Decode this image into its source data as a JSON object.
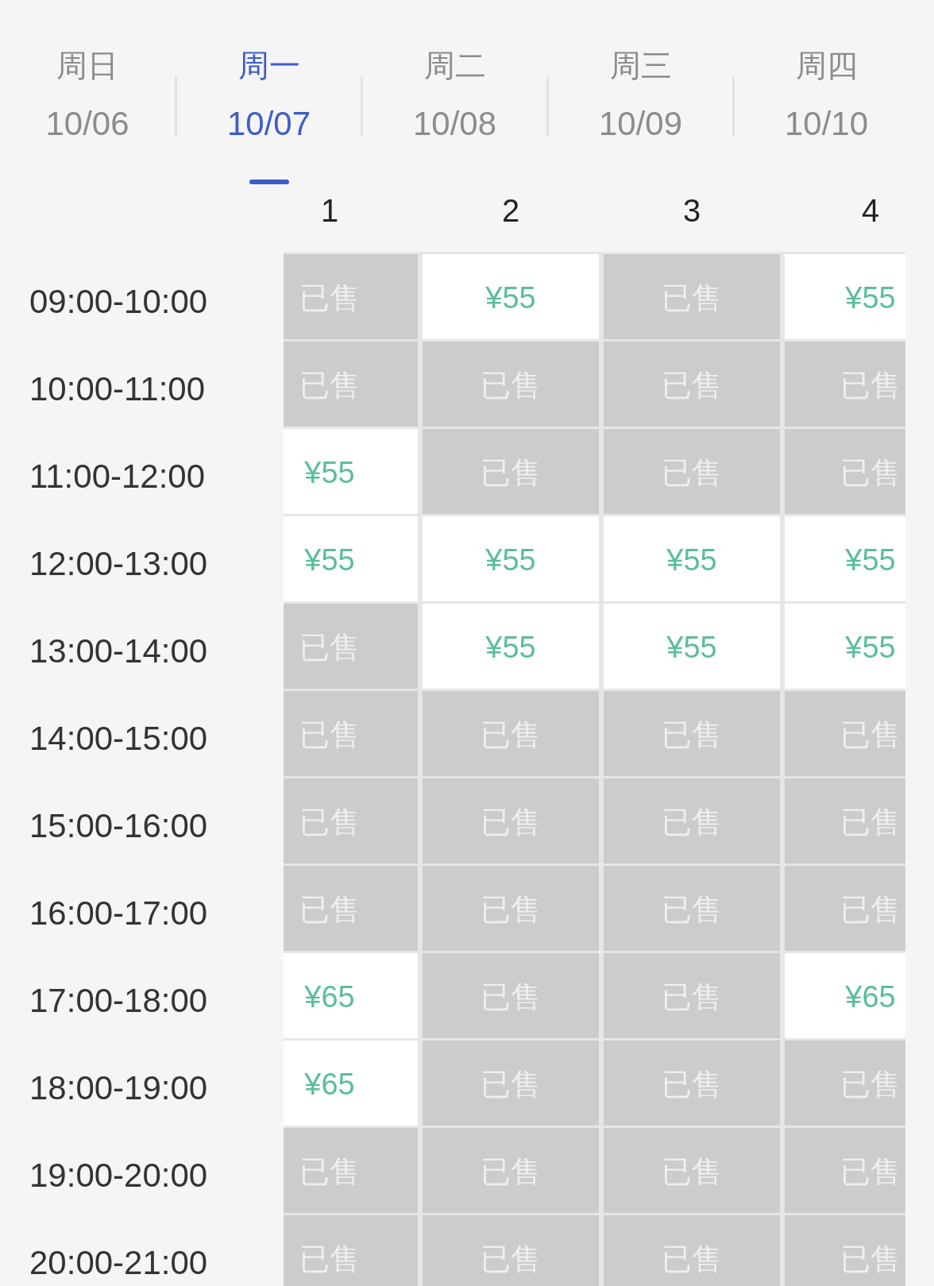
{
  "day_tabs": [
    {
      "weekday": "周日",
      "date": "10/06",
      "selected": false
    },
    {
      "weekday": "周一",
      "date": "10/07",
      "selected": true
    },
    {
      "weekday": "周二",
      "date": "10/08",
      "selected": false
    },
    {
      "weekday": "周三",
      "date": "10/09",
      "selected": false
    },
    {
      "weekday": "周四",
      "date": "10/10",
      "selected": false
    }
  ],
  "court_columns": [
    "1",
    "2",
    "3",
    "4"
  ],
  "time_slots": [
    {
      "time": "09:00-10:00",
      "cells": [
        {
          "kind": "sold",
          "text": "已售"
        },
        {
          "kind": "available",
          "text": "¥55"
        },
        {
          "kind": "sold",
          "text": "已售"
        },
        {
          "kind": "available",
          "text": "¥55"
        }
      ]
    },
    {
      "time": "10:00-11:00",
      "cells": [
        {
          "kind": "sold",
          "text": "已售"
        },
        {
          "kind": "sold",
          "text": "已售"
        },
        {
          "kind": "sold",
          "text": "已售"
        },
        {
          "kind": "sold",
          "text": "已售"
        }
      ]
    },
    {
      "time": "11:00-12:00",
      "cells": [
        {
          "kind": "available",
          "text": "¥55"
        },
        {
          "kind": "sold",
          "text": "已售"
        },
        {
          "kind": "sold",
          "text": "已售"
        },
        {
          "kind": "sold",
          "text": "已售"
        }
      ]
    },
    {
      "time": "12:00-13:00",
      "cells": [
        {
          "kind": "available",
          "text": "¥55"
        },
        {
          "kind": "available",
          "text": "¥55"
        },
        {
          "kind": "available",
          "text": "¥55"
        },
        {
          "kind": "available",
          "text": "¥55"
        }
      ]
    },
    {
      "time": "13:00-14:00",
      "cells": [
        {
          "kind": "sold",
          "text": "已售"
        },
        {
          "kind": "available",
          "text": "¥55"
        },
        {
          "kind": "available",
          "text": "¥55"
        },
        {
          "kind": "available",
          "text": "¥55"
        }
      ]
    },
    {
      "time": "14:00-15:00",
      "cells": [
        {
          "kind": "sold",
          "text": "已售"
        },
        {
          "kind": "sold",
          "text": "已售"
        },
        {
          "kind": "sold",
          "text": "已售"
        },
        {
          "kind": "sold",
          "text": "已售"
        }
      ]
    },
    {
      "time": "15:00-16:00",
      "cells": [
        {
          "kind": "sold",
          "text": "已售"
        },
        {
          "kind": "sold",
          "text": "已售"
        },
        {
          "kind": "sold",
          "text": "已售"
        },
        {
          "kind": "sold",
          "text": "已售"
        }
      ]
    },
    {
      "time": "16:00-17:00",
      "cells": [
        {
          "kind": "sold",
          "text": "已售"
        },
        {
          "kind": "sold",
          "text": "已售"
        },
        {
          "kind": "sold",
          "text": "已售"
        },
        {
          "kind": "sold",
          "text": "已售"
        }
      ]
    },
    {
      "time": "17:00-18:00",
      "cells": [
        {
          "kind": "available",
          "text": "¥65"
        },
        {
          "kind": "sold",
          "text": "已售"
        },
        {
          "kind": "sold",
          "text": "已售"
        },
        {
          "kind": "available",
          "text": "¥65"
        }
      ]
    },
    {
      "time": "18:00-19:00",
      "cells": [
        {
          "kind": "available",
          "text": "¥65"
        },
        {
          "kind": "sold",
          "text": "已售"
        },
        {
          "kind": "sold",
          "text": "已售"
        },
        {
          "kind": "sold",
          "text": "已售"
        }
      ]
    },
    {
      "time": "19:00-20:00",
      "cells": [
        {
          "kind": "sold",
          "text": "已售"
        },
        {
          "kind": "sold",
          "text": "已售"
        },
        {
          "kind": "sold",
          "text": "已售"
        },
        {
          "kind": "sold",
          "text": "已售"
        }
      ]
    },
    {
      "time": "20:00-21:00",
      "cells": [
        {
          "kind": "sold",
          "text": "已售"
        },
        {
          "kind": "sold",
          "text": "已售"
        },
        {
          "kind": "sold",
          "text": "已售"
        },
        {
          "kind": "sold",
          "text": "已售"
        }
      ]
    }
  ]
}
